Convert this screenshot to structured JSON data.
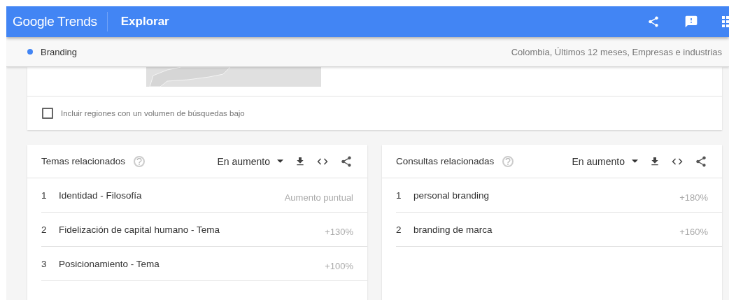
{
  "header": {
    "logo": "Google Trends",
    "title": "Explorar"
  },
  "search_bar": {
    "term": "Branding",
    "filters": "Colombia, Últimos 12 meses, Empresas e industrias"
  },
  "region_card": {
    "checkbox": {
      "label": "Incluir regiones con un volumen de búsquedas bajo",
      "checked": false
    }
  },
  "related": [
    {
      "title": "Temas relacionados",
      "sort": "En aumento",
      "rows": [
        {
          "rank": "1",
          "label": "Identidad - Filosofía",
          "value": "Aumento puntual"
        },
        {
          "rank": "2",
          "label": "Fidelización de capital humano - Tema",
          "value": "+130%"
        },
        {
          "rank": "3",
          "label": "Posicionamiento - Tema",
          "value": "+100%"
        }
      ]
    },
    {
      "title": "Consultas relacionadas",
      "sort": "En aumento",
      "rows": [
        {
          "rank": "1",
          "label": "personal branding",
          "value": "+180%"
        },
        {
          "rank": "2",
          "label": "branding de marca",
          "value": "+160%"
        }
      ]
    }
  ]
}
